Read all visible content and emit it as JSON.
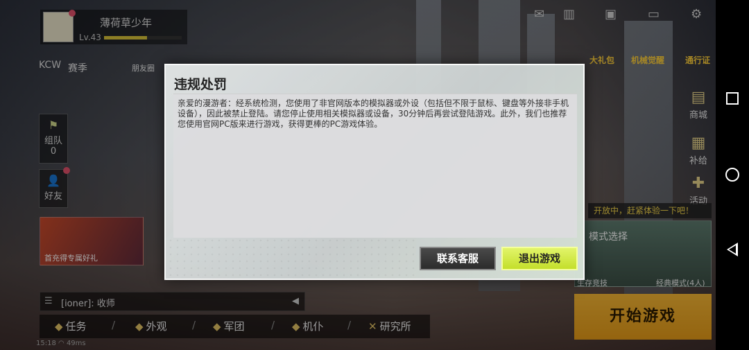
{
  "profile": {
    "name": "薄荷草少年",
    "level": "Lv.43",
    "level_progress_pct": 55,
    "season_badge": "KCW",
    "season_label": "赛季",
    "friend_circle": "朋友圈"
  },
  "left_buttons": {
    "team_label": "组队",
    "team_count": "0",
    "friends_label": "好友"
  },
  "promo_card": {
    "text": "首充得专属好礼"
  },
  "chat": {
    "text": "[ioner]: 收师"
  },
  "bottom_nav": {
    "items": [
      {
        "label": "任务",
        "icon": "task-icon"
      },
      {
        "label": "外观",
        "icon": "outfit-icon"
      },
      {
        "label": "军团",
        "icon": "legion-icon"
      },
      {
        "label": "机仆",
        "icon": "robot-icon"
      },
      {
        "label": "研究所",
        "icon": "research-icon"
      }
    ]
  },
  "status": {
    "time": "15:18",
    "ping": "49ms"
  },
  "top_events": {
    "event1": "大礼包",
    "event2": "机械觉醒",
    "event3": "通行证"
  },
  "right_panel": {
    "shop": "商城",
    "supply": "补给",
    "activity": "活动",
    "promo_banner": "开放中，赶紧体验一下吧！",
    "mode_title": "模式选择",
    "mode_left": "生存竞技",
    "mode_right": "经典模式(4人)",
    "start_button": "开始游戏"
  },
  "dialog": {
    "title": "违规处罚",
    "message": "亲爱的漫游者：经系统检测，您使用了非官网版本的模拟器或外设（包括但不限于鼠标、键盘等外接非手机设备），因此被禁止登陆。请您停止使用相关模拟器或设备，30分钟后再尝试登陆游戏。此外，我们也推荐您使用官网PC版来进行游戏，获得更棒的PC游戏体验。",
    "contact_button": "联系客服",
    "exit_button": "退出游戏"
  },
  "colors": {
    "exit_button": "#d4ea44",
    "contact_button": "#3a3a3a",
    "dialog_bg": "#e4e8e8",
    "accent_yellow": "#f4b534"
  }
}
